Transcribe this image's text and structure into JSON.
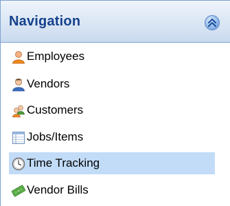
{
  "navigation": {
    "title": "Navigation",
    "collapse_icon": "double-chevron-up-icon",
    "items": [
      {
        "label": "Employees",
        "icon": "employee-person-icon",
        "selected": false
      },
      {
        "label": "Vendors",
        "icon": "vendor-person-icon",
        "selected": false
      },
      {
        "label": "Customers",
        "icon": "customers-group-icon",
        "selected": false
      },
      {
        "label": "Jobs/Items",
        "icon": "table-list-icon",
        "selected": false
      },
      {
        "label": "Time Tracking",
        "icon": "clock-icon",
        "selected": true
      },
      {
        "label": "Vendor Bills",
        "icon": "money-bill-icon",
        "selected": false
      }
    ]
  },
  "colors": {
    "header_text": "#15428b",
    "selection": "#c2dcf8",
    "border": "#7fa2cf"
  }
}
